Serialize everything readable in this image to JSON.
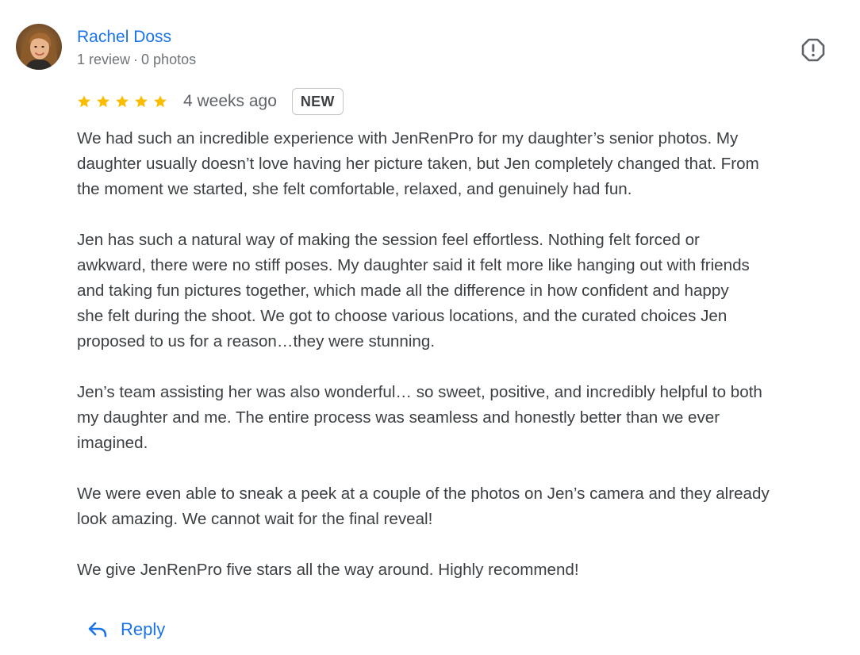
{
  "reviewer": {
    "name": "Rachel Doss",
    "reviews": "1 review",
    "separator": "·",
    "photos": "0 photos",
    "avatar_icon": "user-photo-avatar"
  },
  "report": {
    "icon": "report-icon"
  },
  "rating": {
    "stars": 5,
    "max_stars": 5,
    "star_color": "#fbbc04",
    "time_ago": "4 weeks ago",
    "badge": "NEW"
  },
  "review": {
    "paragraphs": [
      "We had such an incredible experience with JenRenPro for my daughter’s senior photos. My\ndaughter usually doesn’t love having her picture taken, but Jen completely changed that. From\nthe moment we started, she felt comfortable, relaxed, and genuinely had fun.",
      "Jen has such a natural way of making the session feel effortless. Nothing felt forced or\nawkward, there were no stiff poses. My daughter said it felt more like hanging out with friends\nand taking fun pictures together, which made all the difference in how confident and happy\nshe felt during the shoot. We got to choose various locations, and the curated choices Jen\nproposed to us for a reason…they were stunning.",
      "Jen’s team assisting her was also wonderful… so sweet, positive, and incredibly helpful to both\nmy daughter and me. The entire process was seamless and honestly better than we ever\nimagined.",
      "We were even able to sneak a peek at a couple of the photos on Jen’s camera and they already\nlook amazing. We cannot wait for the final reveal!",
      "We give JenRenPro five stars all the way around. Highly recommend!"
    ]
  },
  "actions": {
    "reply_label": "Reply",
    "reply_icon": "reply-arrow-icon"
  },
  "colors": {
    "link": "#1a73e8",
    "text": "#3c4043",
    "muted": "#70757a",
    "star": "#fbbc04"
  }
}
